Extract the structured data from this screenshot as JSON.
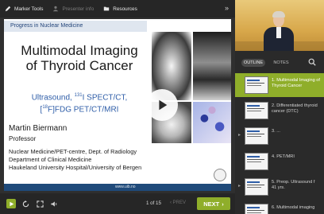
{
  "toolbar": {
    "items": [
      {
        "label": "Marker Tools",
        "enabled": true
      },
      {
        "label": "Presenter info",
        "enabled": false
      },
      {
        "label": "Resources",
        "enabled": true
      }
    ],
    "expand_icon": "chevron-double-right-icon"
  },
  "slide": {
    "header": "Progress in Nuclear Medicine",
    "title_line1": "Multimodal Imaging",
    "title_line2": "of Thyroid Cancer",
    "sub_line1_a": "Ultrasound, ",
    "sub_line1_sup": "131",
    "sub_line1_b": "I SPECT/CT,",
    "sub_line2_a": "[",
    "sub_line2_sup": "18",
    "sub_line2_b": "F]FDG PET/CT/MRI",
    "author": "Martin Biermann",
    "position": "Professor",
    "dept1": "Nuclear Medicine/PET-centre, Dept. of Radiology",
    "dept2": "Department of Clinical Medicine",
    "dept3": "Haukeland University Hospital/University of Bergen",
    "footer_url": "www.uib.no"
  },
  "player": {
    "page_info": "1 of 15",
    "prev_label": "PREV",
    "next_label": "NEXT",
    "accent": "#8fae2a"
  },
  "sidebar": {
    "tab_outline": "OUTLINE",
    "tab_notes": "NOTES",
    "items": [
      {
        "label": "1. Multimodal Imaging of Thyroid Cancer",
        "active": true,
        "expandable": false
      },
      {
        "label": "2. Differentiated thyroid cancer (DTC)",
        "active": false,
        "expandable": false
      },
      {
        "label": "3. ...",
        "active": false,
        "expandable": true
      },
      {
        "label": "4. PET/MRI",
        "active": false,
        "expandable": false
      },
      {
        "label": "5. Preop. Ultrasound f 41 yrs.",
        "active": false,
        "expandable": true
      },
      {
        "label": "6. Multimodal imaging",
        "active": false,
        "expandable": false
      }
    ]
  }
}
